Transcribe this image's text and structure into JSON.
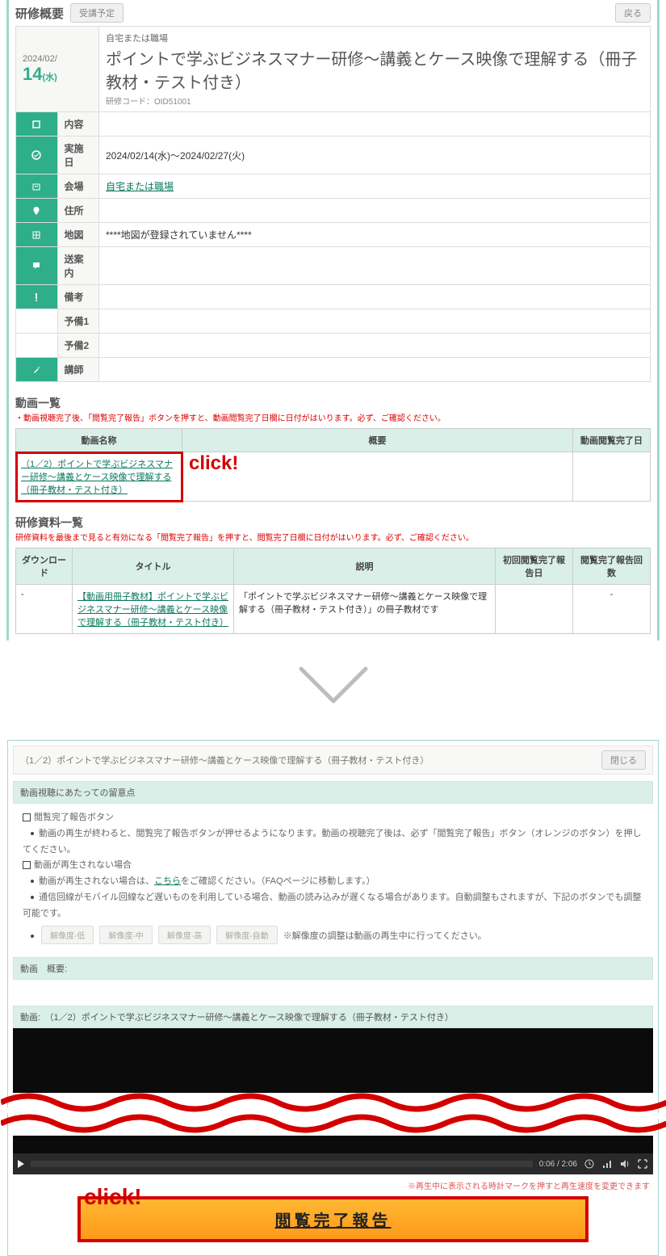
{
  "top": {
    "section": "研修概要",
    "btn_schedule": "受講予定",
    "btn_back": "戻る",
    "date_ym": "2024/02/",
    "date_d": "14",
    "date_w": "(水)",
    "location_sub": "自宅または職場",
    "title_main": "ポイントで学ぶビジネスマナー研修～講義とケース映像で理解する（冊子教材・テスト付き）",
    "code": "研修コード：OID51001",
    "rows": {
      "content_l": "内容",
      "date_l": "実施日",
      "date_v": "2024/02/14(水)～2024/02/27(火)",
      "venue_l": "会場",
      "venue_v": "自宅または職場",
      "addr_l": "住所",
      "map_l": "地図",
      "map_v": "****地図が登録されていません****",
      "guide_l": "送案内",
      "note_l": "備考",
      "sp1_l": "予備1",
      "sp2_l": "予備2",
      "lect_l": "講師"
    }
  },
  "video": {
    "h": "動画一覧",
    "warn": "・動画視聴完了後、「閲覧完了報告」ボタンを押すと、動画閲覧完了日欄に日付がはいります。必ず、ご確認ください。",
    "th1": "動画名称",
    "th2": "概要",
    "th3": "動画閲覧完了日",
    "link": "（1／2）ポイントで学ぶビジネスマナー研修～講義とケース映像で理解する（冊子教材・テスト付き）",
    "click": "click!"
  },
  "mat": {
    "h": "研修資料一覧",
    "warn": "研修資料を最後まで見ると有効になる「閲覧完了報告」を押すと、閲覧完了日欄に日付がはいります。必ず、ご確認ください。",
    "th1": "ダウンロード",
    "th2": "タイトル",
    "th3": "説明",
    "th4": "初回閲覧完了報告日",
    "th5": "閲覧完了報告回数",
    "dl": "-",
    "title": "【動画用冊子教材】ポイントで学ぶビジネスマナー研修～講義とケース映像で理解する（冊子教材・テスト付き）",
    "desc": "「ポイントで学ぶビジネスマナー研修～講義とケース映像で理解する（冊子教材・テスト付き）」の冊子教材です"
  },
  "bottom": {
    "bc": "（1／2）ポイントで学ぶビジネスマナー研修～講義とケース映像で理解する（冊子教材・テスト付き）",
    "close": "閉じる",
    "green1": "動画視聴にあたっての留意点",
    "b1": "閲覧完了報告ボタン",
    "li1": "動画の再生が終わると、閲覧完了報告ボタンが押せるようになります。動画の視聴完了後は、必ず「閲覧完了報告」ボタン（オレンジのボタン）を押してください。",
    "b2": "動画が再生されない場合",
    "li2a": "動画が再生されない場合は、",
    "li2link": "こちら",
    "li2b": "をご確認ください。（FAQページに移動します。）",
    "li3": "通信回線がモバイル回線など遅いものを利用している場合、動画の読み込みが遅くなる場合があります。自動調整もされますが、下記のボタンでも調整可能です。",
    "sb1": "解像度-低",
    "sb2": "解像度-中",
    "sb3": "解像度-高",
    "sb4": "解像度-自動",
    "sbnote": "※解像度の調整は動画の再生中に行ってください。",
    "green2": "動画　概要:",
    "green3": "動画:　（1／2）ポイントで学ぶビジネスマナー研修～講義とケース映像で理解する（冊子教材・テスト付き）",
    "time": "0:06 / 2:06",
    "note_r": "※再生中に表示される時計マークを押すと再生速度を変更できます",
    "bigbtn": "閲覧完了報告",
    "click": "click!"
  }
}
